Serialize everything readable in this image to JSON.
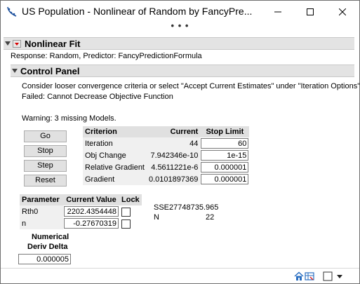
{
  "window": {
    "title": "US Population - Nonlinear of Random by FancyPre...",
    "overflow_dots": "• • •"
  },
  "report": {
    "title": "Nonlinear Fit",
    "response_line": "Response: Random, Predictor: FancyPredictionFormula"
  },
  "control_panel": {
    "title": "Control Panel",
    "message1": "Consider looser convergence criteria or select \"Accept Current Estimates\" under \"Iteration Options\".",
    "message2": "Failed: Cannot Decrease Objective Function",
    "warning": "Warning: 3 missing Models.",
    "buttons": {
      "go": "Go",
      "stop": "Stop",
      "step": "Step",
      "reset": "Reset"
    },
    "criteria": {
      "headers": [
        "Criterion",
        "Current",
        "Stop Limit"
      ],
      "rows": [
        {
          "criterion": "Iteration",
          "current": "44",
          "limit": "60"
        },
        {
          "criterion": "Obj Change",
          "current": "7.942346e-10",
          "limit": "1e-15"
        },
        {
          "criterion": "Relative Gradient",
          "current": "4.5611221e-6",
          "limit": "0.000001"
        },
        {
          "criterion": "Gradient",
          "current": "0.0101897369",
          "limit": "0.000001"
        }
      ]
    },
    "parameters": {
      "headers": [
        "Parameter",
        "Current Value",
        "Lock"
      ],
      "rows": [
        {
          "name": "Rth0",
          "value": "2202.4354448"
        },
        {
          "name": "n",
          "value": "-0.27670319"
        }
      ]
    },
    "stats": {
      "sse_label": "SSE",
      "sse_value": "27748735.965",
      "n_label": "N",
      "n_value": "22"
    },
    "deriv": {
      "label_line1": "Numerical",
      "label_line2": "Deriv Delta",
      "value": "0.000005"
    }
  },
  "colors": {
    "header_bg": "#e3e3e3",
    "red_triangle": "#d80000",
    "cell_bg": "#f0f0f0"
  }
}
